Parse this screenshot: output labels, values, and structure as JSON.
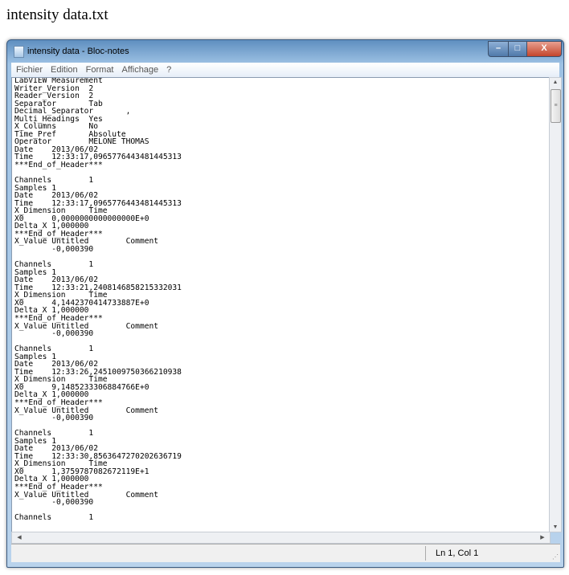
{
  "page_title": "intensity data.txt",
  "window": {
    "title": "intensity data - Bloc-notes",
    "minimize": "–",
    "maximize": "□",
    "close": "X"
  },
  "menu": [
    "Fichier",
    "Edition",
    "Format",
    "Affichage",
    "?"
  ],
  "content_lines": [
    "LabVIEW Measurement",
    "Writer_Version\t2",
    "Reader_Version\t2",
    "Separator\tTab",
    "Decimal_Separator\t,",
    "Multi_Headings\tYes",
    "X_Columns\tNo",
    "Time_Pref\tAbsolute",
    "Operator\tMELONE THOMAS",
    "Date\t2013/06/02",
    "Time\t12:33:17,0965776443481445313",
    "***End_of_Header***",
    "",
    "Channels\t1",
    "Samples\t1",
    "Date\t2013/06/02",
    "Time\t12:33:17,0965776443481445313",
    "X_Dimension\tTime",
    "X0\t0,0000000000000000E+0",
    "Delta_X\t1,000000",
    "***End_of_Header***",
    "X_Value\tUntitled\tComment",
    "\t-0,000390",
    "",
    "Channels\t1",
    "Samples\t1",
    "Date\t2013/06/02",
    "Time\t12:33:21,2408146858215332031",
    "X_Dimension\tTime",
    "X0\t4,1442370414733887E+0",
    "Delta_X\t1,000000",
    "***End_of_Header***",
    "X_Value\tUntitled\tComment",
    "\t-0,000390",
    "",
    "Channels\t1",
    "Samples\t1",
    "Date\t2013/06/02",
    "Time\t12:33:26,2451009750366210938",
    "X_Dimension\tTime",
    "X0\t9,1485233306884766E+0",
    "Delta_X\t1,000000",
    "***End_of_Header***",
    "X_Value\tUntitled\tComment",
    "\t-0,000390",
    "",
    "Channels\t1",
    "Samples\t1",
    "Date\t2013/06/02",
    "Time\t12:33:30,8563647270202636719",
    "X_Dimension\tTime",
    "X0\t1,3759787082672119E+1",
    "Delta_X\t1,000000",
    "***End_of_Header***",
    "X_Value\tUntitled\tComment",
    "\t-0,000390",
    "",
    "Channels\t1"
  ],
  "status": {
    "position": "Ln 1, Col 1"
  }
}
